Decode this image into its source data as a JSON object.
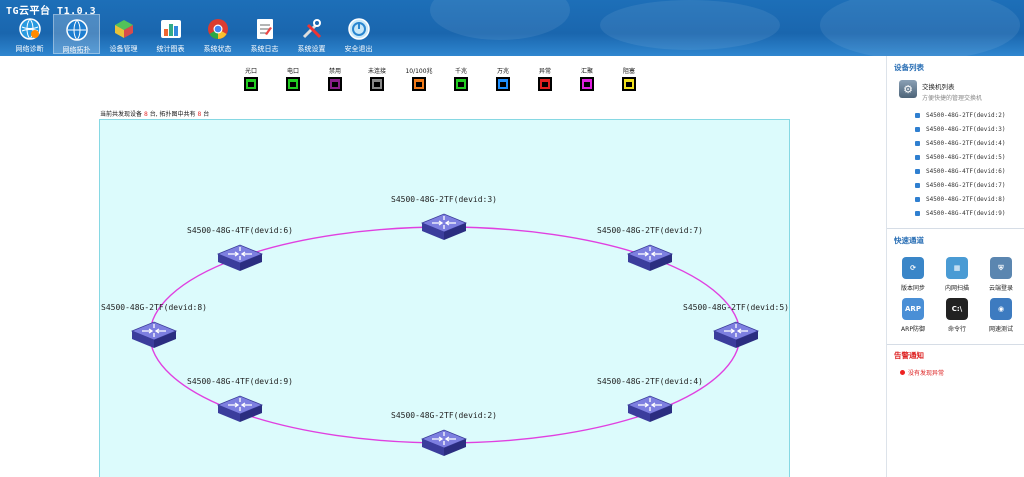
{
  "app": {
    "title": "TG云平台  T1.0.3"
  },
  "nav": [
    {
      "label": "网络诊断",
      "icon": "globe-icon",
      "active": false
    },
    {
      "label": "网络拓扑",
      "icon": "network-globe-icon",
      "active": true
    },
    {
      "label": "设备管理",
      "icon": "device-cube-icon",
      "active": false
    },
    {
      "label": "统计图表",
      "icon": "chart-icon",
      "active": false
    },
    {
      "label": "系统状态",
      "icon": "chrome-icon",
      "active": false
    },
    {
      "label": "系统日志",
      "icon": "log-icon",
      "active": false
    },
    {
      "label": "系统设置",
      "icon": "tools-icon",
      "active": false
    },
    {
      "label": "安全退出",
      "icon": "power-icon",
      "active": false
    }
  ],
  "legend": [
    {
      "label": "光口",
      "color": "#22cc22",
      "icon": "port-icon"
    },
    {
      "label": "电口",
      "color": "#22cc22",
      "icon": "port-icon"
    },
    {
      "label": "禁用",
      "color": "#8a1e8a",
      "icon": "port-icon"
    },
    {
      "label": "未连接",
      "color": "#888888",
      "icon": "port-icon"
    },
    {
      "label": "10/100兆",
      "color": "#f07a1a",
      "icon": "port-icon"
    },
    {
      "label": "千兆",
      "color": "#22cc22",
      "icon": "port-icon"
    },
    {
      "label": "万兆",
      "color": "#1e90ff",
      "icon": "port-icon"
    },
    {
      "label": "异常",
      "color": "#e02020",
      "icon": "port-icon"
    },
    {
      "label": "汇聚",
      "color": "#e020e0",
      "icon": "port-icon"
    },
    {
      "label": "阻塞",
      "color": "#f0e020",
      "icon": "port-icon"
    }
  ],
  "summary": {
    "prefix": "当前共发现设备",
    "found": "8",
    "mid": "台, 拓扑图中共有",
    "shown": "8",
    "suffix": "台"
  },
  "topology": {
    "ring_color": "#e040e0",
    "devices": [
      {
        "label": "S4500-48G-2TF(devid:3)"
      },
      {
        "label": "S4500-48G-2TF(devid:7)"
      },
      {
        "label": "S4500-48G-2TF(devid:5)"
      },
      {
        "label": "S4500-48G-2TF(devid:4)"
      },
      {
        "label": "S4500-48G-2TF(devid:2)"
      },
      {
        "label": "S4500-48G-4TF(devid:9)"
      },
      {
        "label": "S4500-48G-2TF(devid:8)"
      },
      {
        "label": "S4500-48G-4TF(devid:6)"
      }
    ]
  },
  "right": {
    "device_list_title": "设备列表",
    "switch_list_title": "交换机列表",
    "switch_list_sub": "方便快捷的管理交换机",
    "devices": [
      "S4500-48G-2TF(devid:2)",
      "S4500-48G-2TF(devid:3)",
      "S4500-48G-2TF(devid:4)",
      "S4500-48G-2TF(devid:5)",
      "S4500-48G-4TF(devid:6)",
      "S4500-48G-2TF(devid:7)",
      "S4500-48G-2TF(devid:8)",
      "S4500-48G-4TF(devid:9)"
    ],
    "quick_title": "快速通道",
    "quick": [
      {
        "label": "版本同步",
        "icon": "sync-icon",
        "text": "⟳",
        "color": "#3a86c8"
      },
      {
        "label": "内网扫描",
        "icon": "scan-icon",
        "text": "▦",
        "color": "#4a9bd4"
      },
      {
        "label": "云端登录",
        "icon": "shield-icon",
        "text": "⛨",
        "color": "#5b86b0"
      },
      {
        "label": "ARP防御",
        "icon": "arp-icon",
        "text": "ARP",
        "color": "#4a8fd6"
      },
      {
        "label": "命令行",
        "icon": "terminal-icon",
        "text": "C:\\",
        "color": "#222222"
      },
      {
        "label": "网速测试",
        "icon": "speed-icon",
        "text": "◉",
        "color": "#3d7bc0"
      }
    ],
    "alert_title": "告警通知",
    "alert_text": "没有发现异常"
  }
}
